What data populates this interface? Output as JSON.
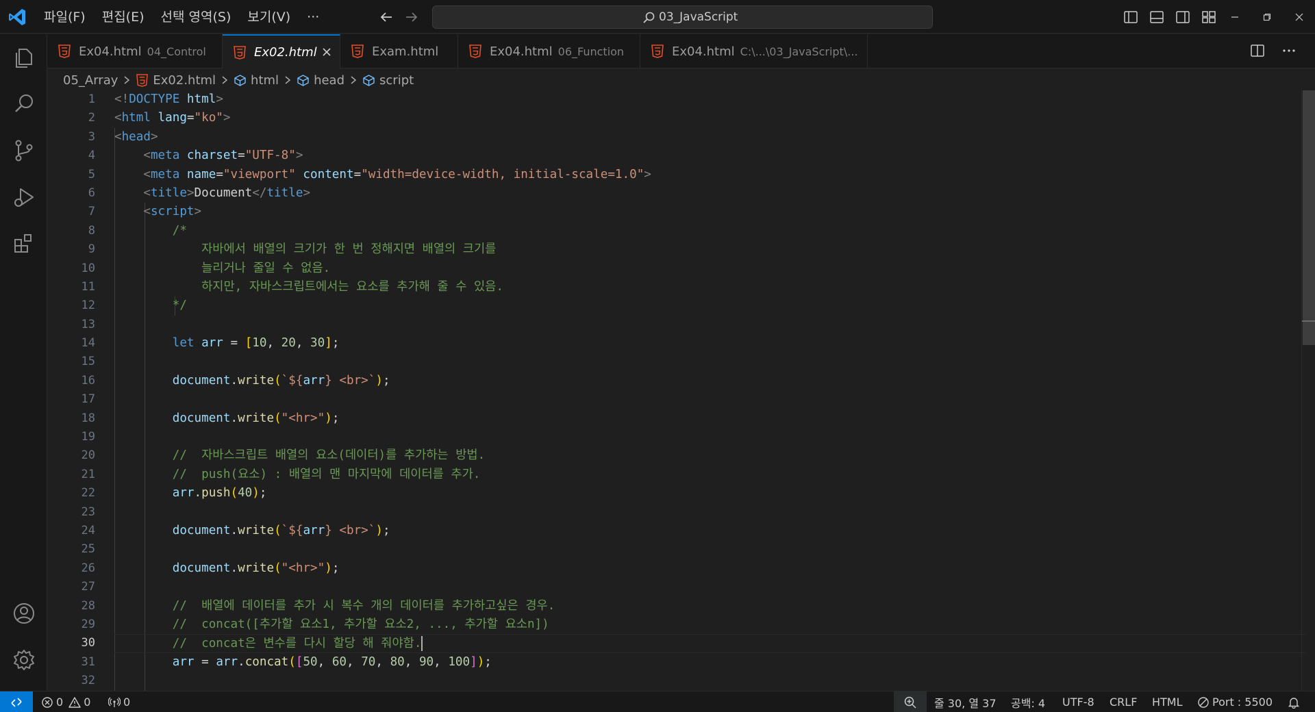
{
  "menu": [
    "파일(F)",
    "편집(E)",
    "선택 영역(S)",
    "보기(V)",
    "···"
  ],
  "search": {
    "text": "03_JavaScript"
  },
  "tabs": [
    {
      "name": "Ex04.html",
      "desc": "04_Control",
      "active": false
    },
    {
      "name": "Ex02.html",
      "desc": "",
      "active": true
    },
    {
      "name": "Exam.html",
      "desc": "",
      "active": false
    },
    {
      "name": "Ex04.html",
      "desc": "06_Function",
      "active": false
    },
    {
      "name": "Ex04.html",
      "desc": "C:\\...\\03_JavaScript\\...",
      "active": false
    }
  ],
  "breadcrumb": {
    "folder": "05_Array",
    "file": "Ex02.html",
    "html": "html",
    "head": "head",
    "script": "script"
  },
  "line_numbers": [
    "1",
    "2",
    "3",
    "4",
    "5",
    "6",
    "7",
    "8",
    "9",
    "10",
    "11",
    "12",
    "13",
    "14",
    "15",
    "16",
    "17",
    "18",
    "19",
    "20",
    "21",
    "22",
    "23",
    "24",
    "25",
    "26",
    "27",
    "28",
    "29",
    "30",
    "31",
    "32"
  ],
  "current_line": 30,
  "code": {
    "l1": [
      "<!",
      "DOCTYPE",
      " html",
      ">"
    ],
    "l2": [
      "<",
      "html",
      " lang",
      "=",
      "\"ko\"",
      ">"
    ],
    "l3": [
      "<",
      "head",
      ">"
    ],
    "l4": [
      "<",
      "meta",
      " charset",
      "=",
      "\"UTF-8\"",
      ">"
    ],
    "l5": [
      "<",
      "meta",
      " name",
      "=",
      "\"viewport\"",
      " content",
      "=",
      "\"width=device-width, initial-scale=1.0\"",
      ">"
    ],
    "l6": [
      "<",
      "title",
      ">",
      "Document",
      "</",
      "title",
      ">"
    ],
    "l7": [
      "<",
      "script",
      ">"
    ],
    "l8": "/*",
    "l9": "    자바에서 배열의 크기가 한 번 정해지면 배열의 크기를",
    "l10": "    늘리거나 줄일 수 없음.",
    "l11": "    하지만, 자바스크립트에서는 요소를 추가해 줄 수 있음.",
    "l12": "*/",
    "l14": [
      "let",
      " arr",
      " = ",
      "[",
      "10",
      ", ",
      "20",
      ", ",
      "30",
      "]",
      ";"
    ],
    "l16": [
      "document",
      ".",
      "write",
      "(",
      "`${",
      "arr",
      "}",
      " <br>`",
      ")",
      ";"
    ],
    "l18": [
      "document",
      ".",
      "write",
      "(",
      "\"<hr>\"",
      ")",
      ";"
    ],
    "l20": "//  자바스크립트 배열의 요소(데이터)를 추가하는 방법.",
    "l21": "//  push(요소) : 배열의 맨 마지막에 데이터를 추가.",
    "l22": [
      "arr",
      ".",
      "push",
      "(",
      "40",
      ")",
      ";"
    ],
    "l24": [
      "document",
      ".",
      "write",
      "(",
      "`${",
      "arr",
      "}",
      " <br>`",
      ")",
      ";"
    ],
    "l26": [
      "document",
      ".",
      "write",
      "(",
      "\"<hr>\"",
      ")",
      ";"
    ],
    "l28": "//  배열에 데이터를 추가 시 복수 개의 데이터를 추가하고싶은 경우.",
    "l29": "//  concat([추가할 요소1, 추가할 요소2, ..., 추가할 요소n])",
    "l30": "//  concat은 변수를 다시 할당 해 줘야함.",
    "l31": [
      "arr",
      " = ",
      "arr",
      ".",
      "concat",
      "(",
      "[",
      "50",
      ", ",
      "60",
      ", ",
      "70",
      ", ",
      "80",
      ", ",
      "90",
      ", ",
      "100",
      "]",
      ")",
      ";"
    ]
  },
  "status": {
    "errors": "0",
    "warnings": "0",
    "ports": "0",
    "position": "줄 30, 열 37",
    "spaces": "공백: 4",
    "encoding": "UTF-8",
    "eol": "CRLF",
    "language": "HTML",
    "port": "Port : 5500"
  },
  "colors": {
    "accent": "#0078d4",
    "html_icon": "#e44d26"
  }
}
